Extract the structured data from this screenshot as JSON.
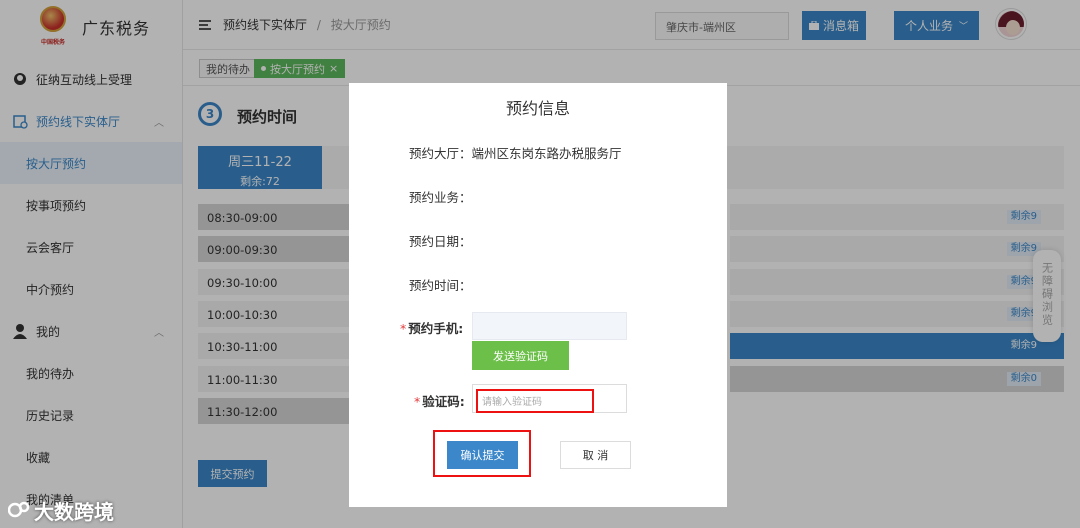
{
  "app": {
    "brand": "广东税务",
    "emblem_text": "中国税务"
  },
  "sidebar": {
    "items": [
      {
        "label": "征纳互动线上受理",
        "icon": "headset-icon"
      },
      {
        "label": "预约线下实体厅",
        "icon": "calendar-clock-icon"
      },
      {
        "label": "按大厅预约"
      },
      {
        "label": "按事项预约"
      },
      {
        "label": "云会客厅"
      },
      {
        "label": "中介预约"
      },
      {
        "label": "我的",
        "icon": "user-icon"
      },
      {
        "label": "我的待办"
      },
      {
        "label": "历史记录"
      },
      {
        "label": "收藏"
      },
      {
        "label": "我的清单"
      }
    ]
  },
  "header": {
    "breadcrumb_parent": "预约线下实体厅",
    "breadcrumb_sep": "/",
    "breadcrumb_current": "按大厅预约",
    "region": "肇庆市-端州区",
    "message_label": "消息箱",
    "business_label": "个人业务"
  },
  "tabs": [
    {
      "label": "我的待办"
    },
    {
      "label": "按大厅预约",
      "close": "×"
    }
  ],
  "main": {
    "step_number": "3",
    "step_title": "预约时间",
    "day": {
      "label": "周三11-22",
      "remain": "剩余:72"
    },
    "slots": [
      {
        "time": "08:30-09:00",
        "remain": "剩余9"
      },
      {
        "time": "09:00-09:30",
        "remain": "剩余9"
      },
      {
        "time": "09:30-10:00",
        "remain": "剩余9"
      },
      {
        "time": "10:00-10:30",
        "remain": "剩余9"
      },
      {
        "time": "10:30-11:00",
        "remain": "剩余9"
      },
      {
        "time": "11:00-11:30",
        "remain": "剩余0"
      },
      {
        "time": "11:30-12:00",
        "remain": ""
      }
    ],
    "submit_label": "提交预约"
  },
  "modal": {
    "title": "预约信息",
    "hall_label": "预约大厅：",
    "hall_value": "端州区东岗东路办税服务厅",
    "business_label": "预约业务：",
    "date_label": "预约日期：",
    "time_label": "预约时间：",
    "phone_required": "*",
    "phone_label": "预约手机:",
    "send_code_label": "发送验证码",
    "code_required": "*",
    "code_label": "验证码:",
    "code_placeholder": "请输入验证码",
    "confirm_label": "确认提交",
    "cancel_label": "取 消"
  },
  "accessibility": {
    "label": "无障碍浏览"
  },
  "watermark": {
    "text": "大数跨境"
  },
  "colors": {
    "primary": "#3b87c9",
    "success": "#6cc04a",
    "highlight": "#e11111"
  }
}
